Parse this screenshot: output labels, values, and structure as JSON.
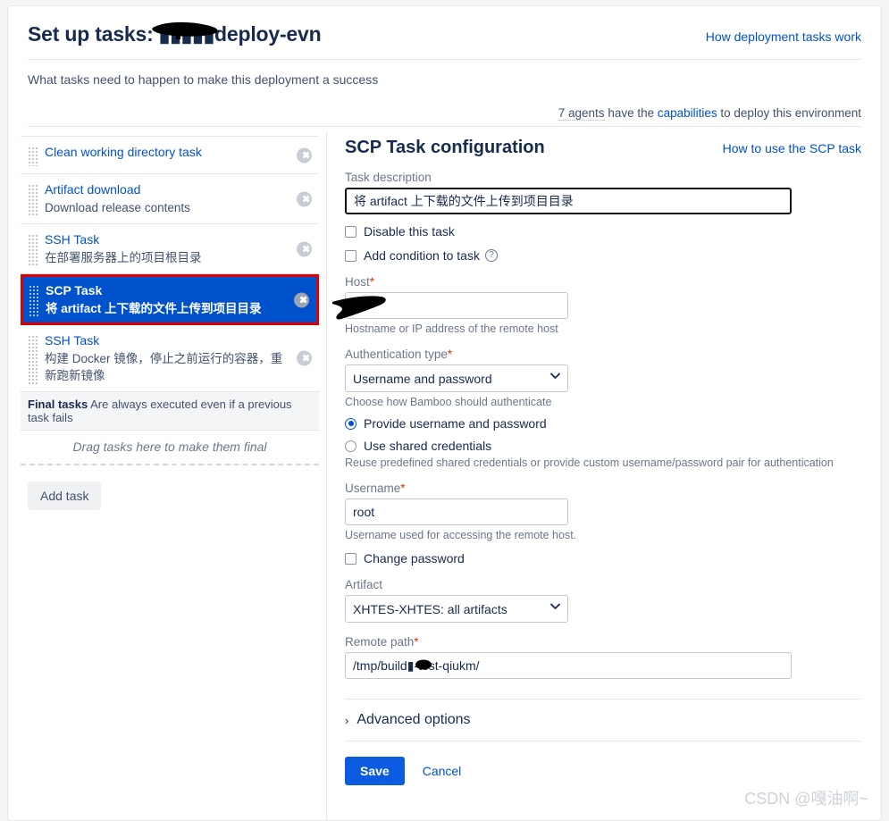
{
  "header": {
    "title": "Set up tasks: ▮▮▮▮▮deploy-evn",
    "help_link": "How deployment tasks work",
    "subtitle": "What tasks need to happen to make this deployment a success",
    "agents_count": "7 agents",
    "agents_mid": " have the ",
    "agents_link": "capabilities",
    "agents_tail": " to deploy this environment"
  },
  "task_list": {
    "tasks": [
      {
        "name": "Clean working directory task",
        "desc": "",
        "selected": false,
        "delete_label": "✖"
      },
      {
        "name": "Artifact download",
        "desc": "Download release contents",
        "selected": false,
        "delete_label": "✖"
      },
      {
        "name": "SSH Task",
        "desc": "在部署服务器上的项目根目录",
        "selected": false,
        "delete_label": "✖"
      },
      {
        "name": "SCP Task",
        "desc": "将 artifact 上下载的文件上传到项目目录",
        "selected": true,
        "delete_label": "✖"
      },
      {
        "name": "SSH Task",
        "desc": "构建 Docker 镜像，停止之前运行的容器，重新跑新镜像",
        "selected": false,
        "delete_label": "✖"
      }
    ],
    "final_tasks_label": "Final tasks",
    "final_tasks_text": " Are always executed even if a previous task fails",
    "drag_hint": "Drag tasks here to make them final",
    "add_task_label": "Add task"
  },
  "config": {
    "section_title": "SCP Task configuration",
    "help_link": "How to use the SCP task",
    "task_description_label": "Task description",
    "task_description_value": "将 artifact 上下载的文件上传到项目目录",
    "disable_task_label": "Disable this task",
    "add_condition_label": "Add condition to task",
    "add_condition_help_glyph": "?",
    "host_label": "Host",
    "host_value": "",
    "host_hint": "Hostname or IP address of the remote host",
    "auth_type_label": "Authentication type",
    "auth_type_value": "Username and password",
    "auth_type_hint": "Choose how Bamboo should authenticate",
    "radio_provide_label": "Provide username and password",
    "radio_shared_label": "Use shared credentials",
    "credentials_hint": "Reuse predefined shared credentials or provide custom username/password pair for authentication",
    "username_label": "Username",
    "username_value": "root",
    "username_hint": "Username used for accessing the remote host.",
    "change_password_label": "Change password",
    "artifact_label": "Artifact",
    "artifact_value": "XHTES-XHTES: all artifacts",
    "remote_path_label": "Remote path",
    "remote_path_value": "/tmp/build▮-test-qiukm/",
    "advanced_options_label": "Advanced options",
    "advanced_chevron": "›",
    "required_marker": "*",
    "save_label": "Save",
    "cancel_label": "Cancel"
  },
  "watermark": "CSDN @嘎油啊~",
  "colors": {
    "accent": "#0052cc",
    "selected_row": "#0052cc",
    "highlight_border": "#e00000",
    "save_button": "#0c5ce0",
    "required": "#de350b"
  }
}
